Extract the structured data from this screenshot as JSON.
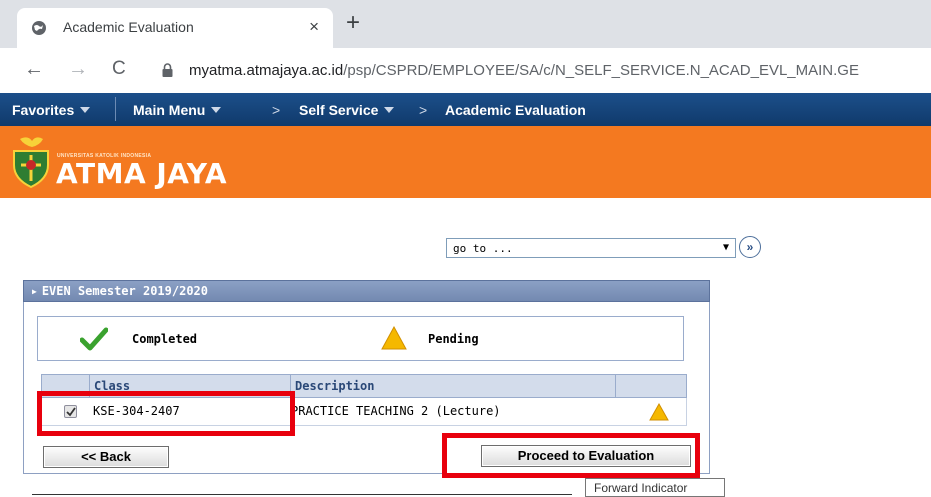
{
  "browser": {
    "tab_title": "Academic Evaluation",
    "close_glyph": "×",
    "new_tab_glyph": "+",
    "back_glyph": "←",
    "forward_glyph": "→",
    "reload_glyph": "C",
    "url_domain": "myatma.atmajaya.ac.id",
    "url_path": "/psp/CSPRD/EMPLOYEE/SA/c/N_SELF_SERVICE.N_ACAD_EVL_MAIN.GE"
  },
  "nav": {
    "favorites": "Favorites",
    "main_menu": "Main Menu",
    "arrow": ">",
    "self_service": "Self Service",
    "current": "Academic Evaluation"
  },
  "brand": {
    "tagline": "UNIVERSITAS KATOLIK INDONESIA",
    "name": "ATMA JAYA",
    "color": "#f47920"
  },
  "goto": {
    "value": "go to ...",
    "caret": "▼",
    "button_glyph": "»"
  },
  "section": {
    "title": "EVEN Semester 2019/2020",
    "legend": {
      "completed": "Completed",
      "pending": "Pending"
    }
  },
  "grid": {
    "columns": [
      "Class",
      "Description"
    ],
    "rows": [
      {
        "class": "KSE-304-2407",
        "description": "PRACTICE TEACHING 2 (Lecture)",
        "checked": true,
        "status": "pending"
      }
    ]
  },
  "buttons": {
    "back": "<< Back",
    "proceed": "Proceed to Evaluation"
  },
  "tooltip": "Forward Indicator",
  "colors": {
    "highlight": "#e8000d",
    "nav_bg": "#174a84",
    "header_bg": "#7e93bb"
  }
}
